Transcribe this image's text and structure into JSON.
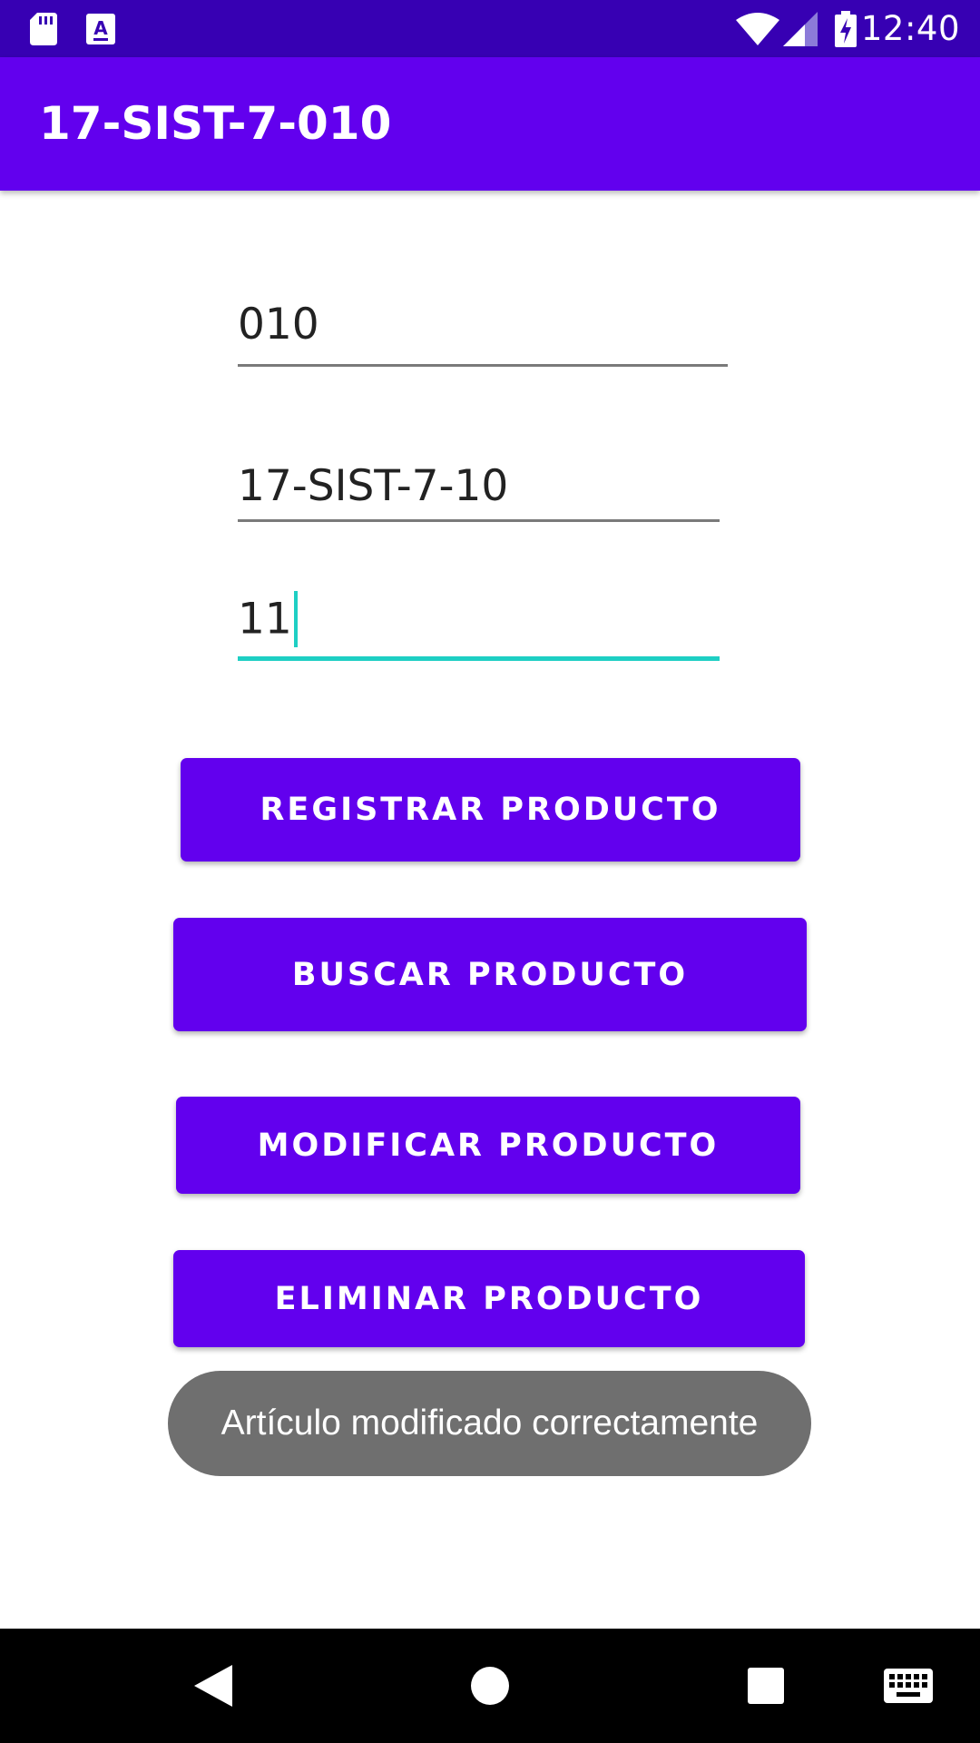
{
  "status_bar": {
    "time": "12:40",
    "icons": [
      "sd-card-icon",
      "font-a-icon",
      "wifi-icon",
      "signal-icon",
      "battery-charging-icon"
    ]
  },
  "app_bar": {
    "title": "17-SIST-7-010"
  },
  "form": {
    "field_code_value": "010",
    "field_description_value": "17-SIST-7-10",
    "field_price_value": "11"
  },
  "buttons": {
    "register": "REGISTRAR PRODUCTO",
    "search": "BUSCAR PRODUCTO",
    "modify": "MODIFICAR PRODUCTO",
    "delete": "ELIMINAR PRODUCTO"
  },
  "toast": {
    "message": "Artículo modificado correctamente"
  },
  "nav_bar": {
    "icons": [
      "back-icon",
      "home-icon",
      "recents-icon",
      "keyboard-icon"
    ]
  },
  "colors": {
    "status_bar": "#3700b3",
    "primary": "#6200ee",
    "focus_accent": "#1ecfc4",
    "toast_bg": "#6f6f6f"
  }
}
